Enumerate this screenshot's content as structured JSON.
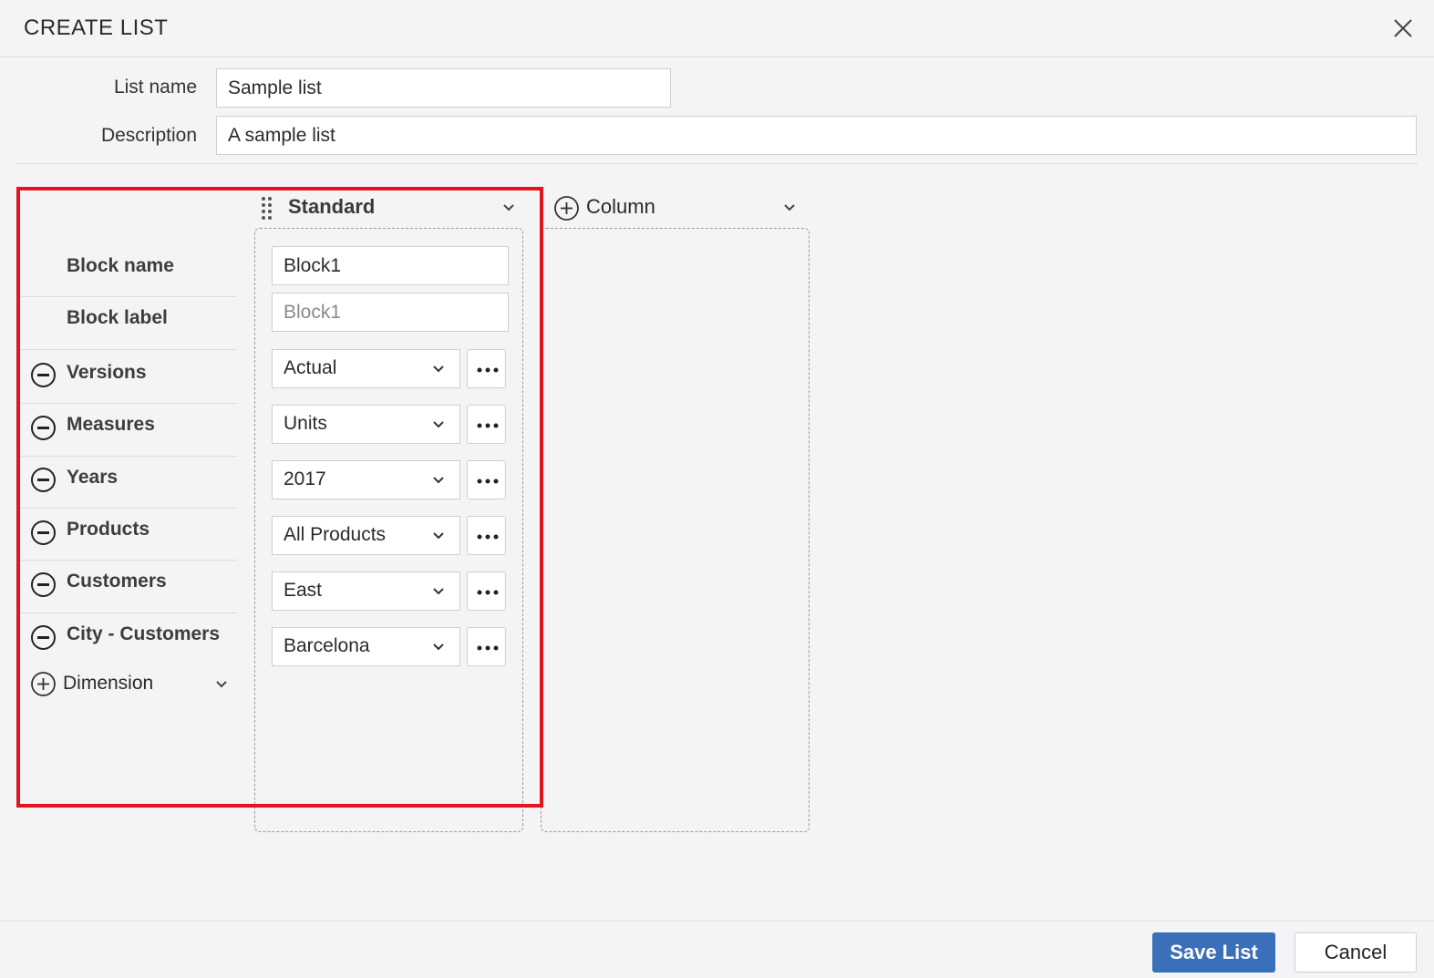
{
  "dialog": {
    "title": "CREATE LIST"
  },
  "form": {
    "list_name_label": "List name",
    "list_name_value": "Sample list",
    "description_label": "Description",
    "description_value": "A sample list"
  },
  "columns": [
    {
      "label": "Standard"
    },
    {
      "label": "Column"
    }
  ],
  "rows": {
    "block_name_label": "Block name",
    "block_label_label": "Block label",
    "dimensions": [
      "Versions",
      "Measures",
      "Years",
      "Products",
      "Customers",
      "City - Customers"
    ],
    "add_dimension_label": "Dimension"
  },
  "block": {
    "name_value": "Block1",
    "label_placeholder": "Block1",
    "selections": [
      "Actual",
      "Units",
      "2017",
      "All Products",
      "East",
      "Barcelona"
    ]
  },
  "footer": {
    "save_label": "Save List",
    "cancel_label": "Cancel"
  },
  "colors": {
    "primary": "#3a6fba",
    "highlight": "#e3141e",
    "background": "#f4f4f6"
  }
}
